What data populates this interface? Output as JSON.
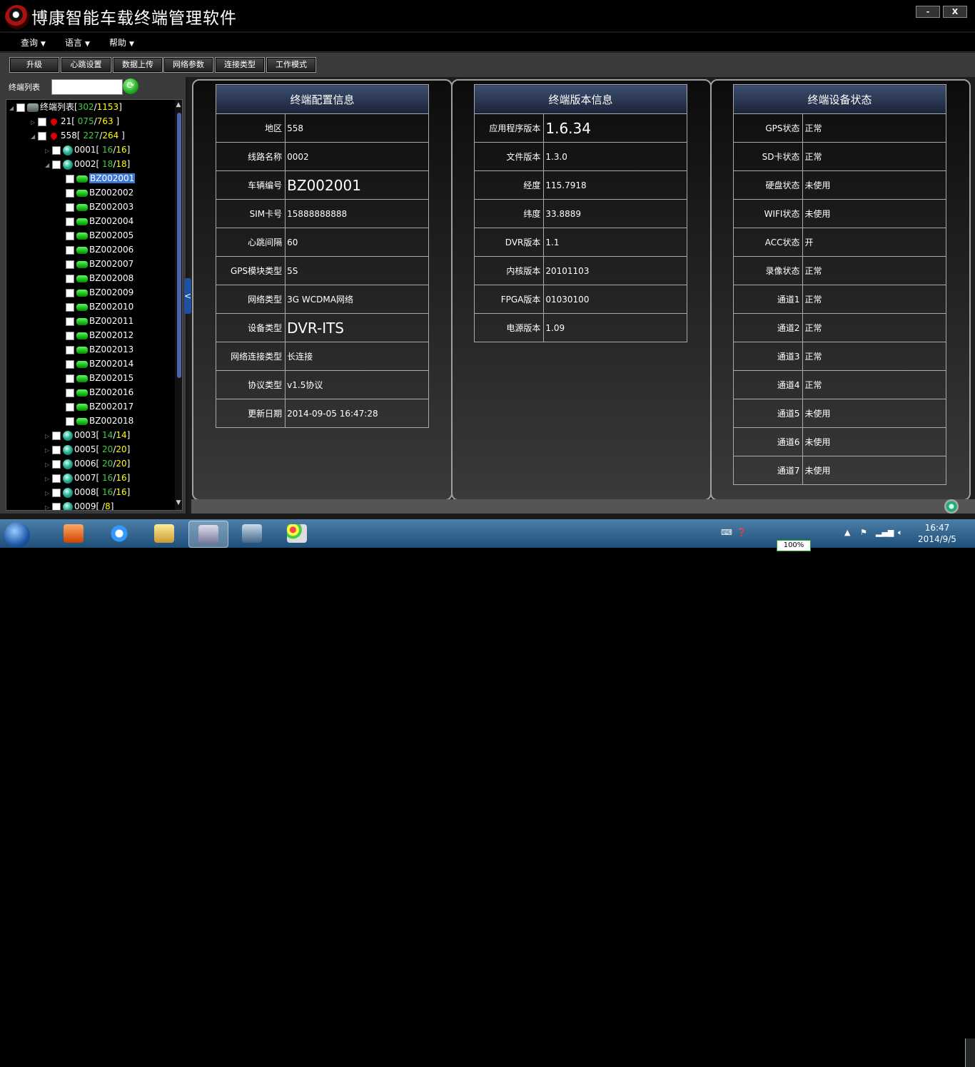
{
  "app": {
    "title": "博康智能车载终端管理软件",
    "minimize": "-",
    "close": "X"
  },
  "menu": [
    {
      "label": "查询"
    },
    {
      "label": "语言"
    },
    {
      "label": "帮助"
    }
  ],
  "toolbar": [
    "升级",
    "心跳设置",
    "数据上传",
    "网络参数",
    "连接类型",
    "工作模式"
  ],
  "tree": {
    "label": "终端列表",
    "root": {
      "name": "终端列表",
      "online": "302",
      "total": "1153"
    },
    "rows": [
      {
        "name": "21",
        "online": "075",
        "total": "763"
      },
      {
        "name": "558",
        "online": "227",
        "total": "264"
      },
      {
        "name": "0001",
        "online": "16",
        "total": "16"
      },
      {
        "name": "0002",
        "online": "18",
        "total": "18"
      },
      {
        "name": "BZ002001"
      },
      {
        "name": "BZ002002"
      },
      {
        "name": "BZ002003"
      },
      {
        "name": "BZ002004"
      },
      {
        "name": "BZ002005"
      },
      {
        "name": "BZ002006"
      },
      {
        "name": "BZ002007"
      },
      {
        "name": "BZ002008"
      },
      {
        "name": "BZ002009"
      },
      {
        "name": "BZ002010"
      },
      {
        "name": "BZ002011"
      },
      {
        "name": "BZ002012"
      },
      {
        "name": "BZ002013"
      },
      {
        "name": "BZ002014"
      },
      {
        "name": "BZ002015"
      },
      {
        "name": "BZ002016"
      },
      {
        "name": "BZ002017"
      },
      {
        "name": "BZ002018"
      },
      {
        "name": "0003",
        "online": "14",
        "total": "14"
      },
      {
        "name": "0005",
        "online": "20",
        "total": "20"
      },
      {
        "name": "0006",
        "online": "20",
        "total": "20"
      },
      {
        "name": "0007",
        "online": "16",
        "total": "16"
      },
      {
        "name": "0008",
        "online": "16",
        "total": "16"
      },
      {
        "name": "0009",
        "online": "",
        "total": "8"
      }
    ]
  },
  "config_panel": {
    "title": "终端配置信息",
    "rows": [
      {
        "label": "地区",
        "value": "558"
      },
      {
        "label": "线路名称",
        "value": "0002"
      },
      {
        "label": "车辆编号",
        "value": "BZ002001"
      },
      {
        "label": "SIM卡号",
        "value": "15888888888"
      },
      {
        "label": "心跳间隔",
        "value": "60"
      },
      {
        "label": "GPS模块类型",
        "value": "5S"
      },
      {
        "label": "网络类型",
        "value": "3G WCDMA网络"
      },
      {
        "label": "设备类型",
        "value": "DVR-ITS"
      },
      {
        "label": "网络连接类型",
        "value": "长连接"
      },
      {
        "label": "协议类型",
        "value": "v1.5协议"
      },
      {
        "label": "更新日期",
        "value": "2014-09-05 16:47:28"
      }
    ]
  },
  "version_panel": {
    "title": "终端版本信息",
    "rows": [
      {
        "label": "应用程序版本",
        "value": "1.6.34"
      },
      {
        "label": "文件版本",
        "value": "1.3.0"
      },
      {
        "label": "经度",
        "value": "115.7918"
      },
      {
        "label": "纬度",
        "value": "33.8889"
      },
      {
        "label": "DVR版本",
        "value": "1.1"
      },
      {
        "label": "内核版本",
        "value": "20101103"
      },
      {
        "label": "FPGA版本",
        "value": "01030100"
      },
      {
        "label": "电源版本",
        "value": "1.09"
      }
    ]
  },
  "status_panel": {
    "title": "终端设备状态",
    "rows": [
      {
        "label": "GPS状态",
        "value": "正常"
      },
      {
        "label": "SD卡状态",
        "value": "正常"
      },
      {
        "label": "硬盘状态",
        "value": "未使用"
      },
      {
        "label": "WIFI状态",
        "value": "未使用"
      },
      {
        "label": "ACC状态",
        "value": "开"
      },
      {
        "label": "录像状态",
        "value": "正常"
      },
      {
        "label": "通道1",
        "value": "正常"
      },
      {
        "label": "通道2",
        "value": "正常"
      },
      {
        "label": "通道3",
        "value": "正常"
      },
      {
        "label": "通道4",
        "value": "正常"
      },
      {
        "label": "通道5",
        "value": "未使用"
      },
      {
        "label": "通道6",
        "value": "未使用"
      },
      {
        "label": "通道7",
        "value": "未使用"
      }
    ]
  },
  "taskbar": {
    "time": "16:47",
    "date": "2014/9/5",
    "battery": "100%"
  }
}
